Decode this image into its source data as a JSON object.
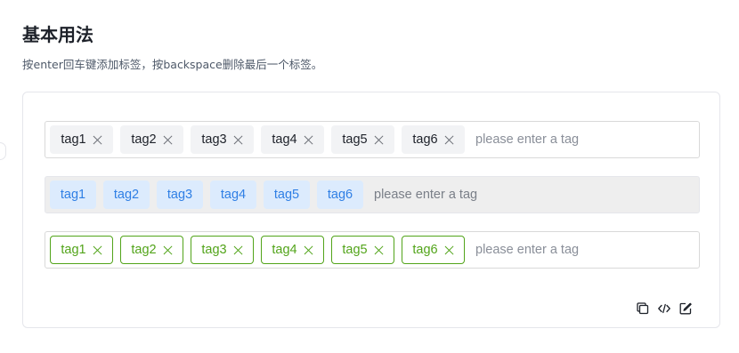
{
  "section": {
    "title": "基本用法",
    "description": "按enter回车键添加标签，按backspace删除最后一个标签。"
  },
  "rows": [
    {
      "variant": "gray-closable",
      "tags": [
        "tag1",
        "tag2",
        "tag3",
        "tag4",
        "tag5",
        "tag6"
      ],
      "placeholder": "please enter a tag"
    },
    {
      "variant": "blue-disabled",
      "tags": [
        "tag1",
        "tag2",
        "tag3",
        "tag4",
        "tag5",
        "tag6"
      ],
      "placeholder": "please enter a tag"
    },
    {
      "variant": "green-outline-closable",
      "tags": [
        "tag1",
        "tag2",
        "tag3",
        "tag4",
        "tag5",
        "tag6"
      ],
      "placeholder": "please enter a tag"
    }
  ],
  "actions": [
    {
      "icon": "copy-icon"
    },
    {
      "icon": "code-icon"
    },
    {
      "icon": "edit-icon"
    }
  ],
  "colors": {
    "tag_blue_bg": "#dcebfd",
    "tag_blue_text": "#2f7fe5",
    "tag_green": "#52a41a",
    "tag_gray_bg": "#f2f3f5"
  }
}
